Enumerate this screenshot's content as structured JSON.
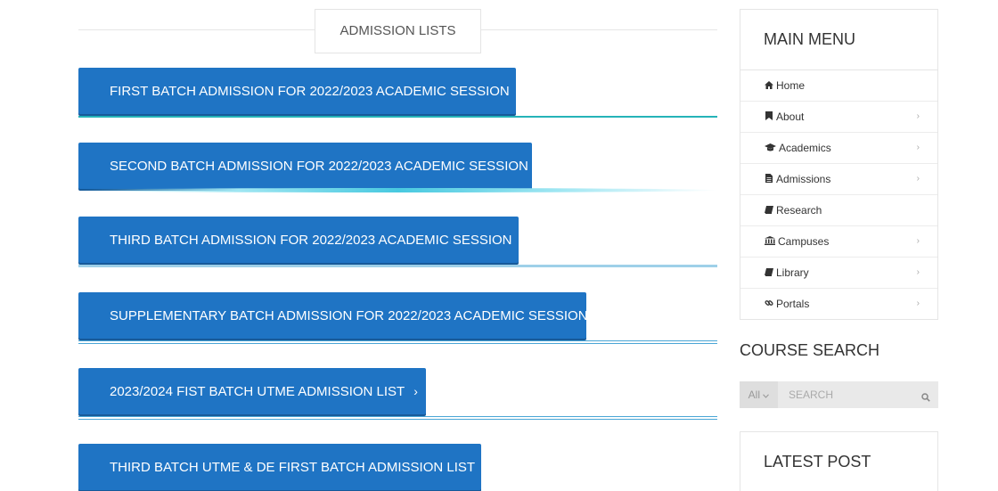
{
  "section": {
    "title": "ADMISSION LISTS"
  },
  "admission_lists": [
    {
      "label": "FIRST BATCH ADMISSION FOR 2022/2023 ACADEMIC SESSION"
    },
    {
      "label": "SECOND BATCH ADMISSION FOR 2022/2023 ACADEMIC SESSION"
    },
    {
      "label": "THIRD BATCH ADMISSION FOR 2022/2023 ACADEMIC SESSION"
    },
    {
      "label": "SUPPLEMENTARY BATCH ADMISSION FOR 2022/2023 ACADEMIC SESSION"
    },
    {
      "label": "2023/2024 FIST BATCH UTME ADMISSION LIST"
    },
    {
      "label": "THIRD BATCH UTME & DE FIRST BATCH ADMISSION LIST"
    }
  ],
  "chevron_glyph": "›",
  "sidebar": {
    "menu_title": "MAIN MENU",
    "menu_items": [
      {
        "label": "Home",
        "icon": "home-icon",
        "has_submenu": false
      },
      {
        "label": "About",
        "icon": "bookmark-icon",
        "has_submenu": true
      },
      {
        "label": "Academics",
        "icon": "graduation-cap-icon",
        "has_submenu": true
      },
      {
        "label": "Admissions",
        "icon": "file-text-icon",
        "has_submenu": true
      },
      {
        "label": "Research",
        "icon": "book-icon",
        "has_submenu": false
      },
      {
        "label": "Campuses",
        "icon": "institution-icon",
        "has_submenu": true
      },
      {
        "label": "Library",
        "icon": "book-icon",
        "has_submenu": true
      },
      {
        "label": "Portals",
        "icon": "link-icon",
        "has_submenu": true
      }
    ],
    "course_search": {
      "title": "COURSE SEARCH",
      "category": "All",
      "placeholder": "SEARCH"
    },
    "latest_post": {
      "title": "LATEST POST"
    }
  },
  "colors": {
    "button_blue": "#1f74c4",
    "teal_line": "#25b3b8",
    "border": "#e5e5e5"
  }
}
